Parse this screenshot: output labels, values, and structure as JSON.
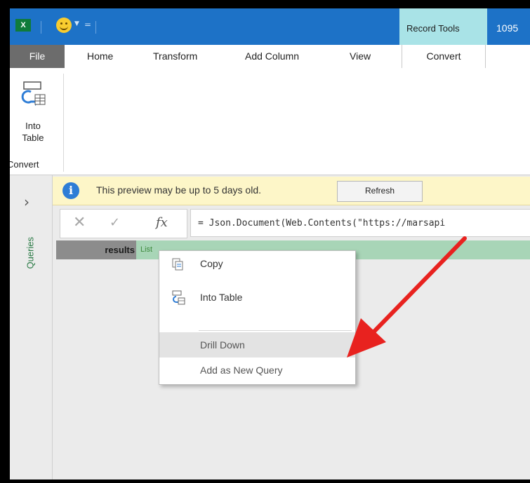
{
  "titlebar": {
    "app_icon_text": "X",
    "context_tab": "Record Tools",
    "title_text": "1095",
    "colors": {
      "titlebar": "#1d72c7",
      "context_tab": "#a9e3e7"
    }
  },
  "ribbon_tabs": [
    {
      "label": "File"
    },
    {
      "label": "Home"
    },
    {
      "label": "Transform"
    },
    {
      "label": "Add Column"
    },
    {
      "label": "View"
    },
    {
      "label": "Convert",
      "active": true
    }
  ],
  "ribbon": {
    "into_table": {
      "label_line1": "Into",
      "label_line2": "Table",
      "icon": "into-table-icon"
    },
    "group_label": "Convert"
  },
  "queries_pane": {
    "expand_icon": "chevron-right-icon",
    "expand_glyph": "›",
    "label": "Queries"
  },
  "infobar": {
    "message": "This preview may be up to 5 days old.",
    "refresh_label": "Refresh",
    "icon_glyph": "i"
  },
  "formula_bar": {
    "cancel_glyph": "✕",
    "commit_glyph": "✓",
    "fx_label": "fx",
    "formula": "= Json.Document(Web.Contents(\"https://marsapi"
  },
  "record": {
    "key": "results",
    "value": "List"
  },
  "context_menu": {
    "items": [
      {
        "label": "Copy",
        "icon": "copy-icon"
      },
      {
        "label": "Into Table",
        "icon": "into-table-icon"
      },
      {
        "label": "Drill Down",
        "highlighted": true
      },
      {
        "label": "Add as New Query"
      }
    ]
  },
  "annotation": {
    "arrow_color": "#e8221f"
  }
}
